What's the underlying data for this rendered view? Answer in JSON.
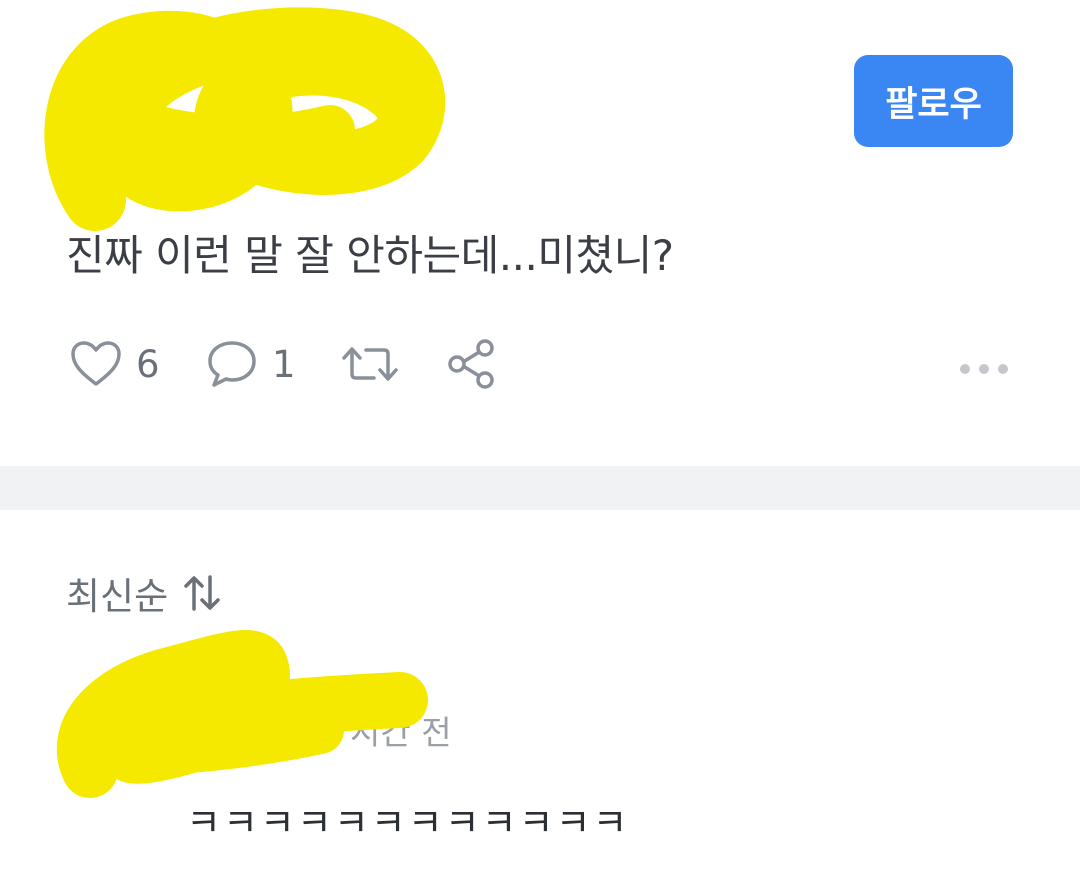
{
  "post": {
    "follow_label": "팔로우",
    "text": "진짜 이런 말 잘 안하는데...미쳤니?",
    "actions": {
      "like_icon": "heart-icon",
      "like_count": "6",
      "comment_icon": "speech-bubble-icon",
      "comment_count": "1",
      "repost_icon": "repost-icon",
      "share_icon": "share-icon",
      "more_icon": "more-dots-icon"
    }
  },
  "comments": {
    "sort_label": "최신순",
    "sort_icon": "sort-arrows-icon",
    "items": [
      {
        "time": "시간 전",
        "text": "ㅋㅋㅋㅋㅋㅋㅋㅋㅋㅋㅋㅋ"
      }
    ]
  },
  "colors": {
    "accent": "#3a86f2",
    "redaction": "#f5e900",
    "divider": "#f0f2f4"
  }
}
